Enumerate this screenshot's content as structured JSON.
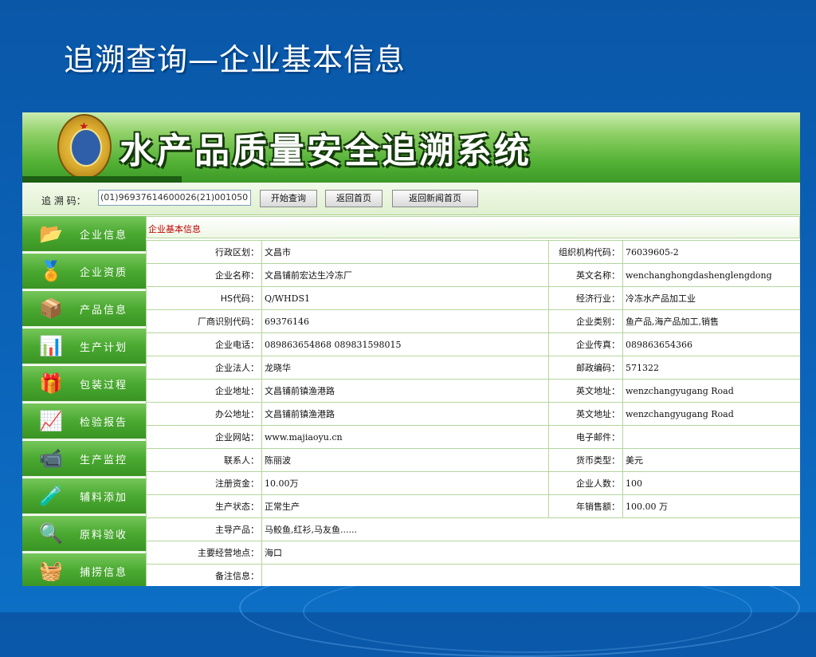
{
  "slide": {
    "title": "追溯查询—企业基本信息"
  },
  "app": {
    "title": "水产品质量安全追溯系统"
  },
  "search": {
    "label": "追 溯 码：",
    "value": "(01)96937614600026(21)001050",
    "buttons": [
      "开始查询",
      "返回首页",
      "返回新闻首页"
    ]
  },
  "sidebar": {
    "items": [
      {
        "label": "企业信息",
        "icon": "folder-icon"
      },
      {
        "label": "企业资质",
        "icon": "medal-icon"
      },
      {
        "label": "产品信息",
        "icon": "products-icon"
      },
      {
        "label": "生产计划",
        "icon": "bar-chart-icon"
      },
      {
        "label": "包装过程",
        "icon": "package-icon"
      },
      {
        "label": "检验报告",
        "icon": "report-icon"
      },
      {
        "label": "生产监控",
        "icon": "monitor-icon"
      },
      {
        "label": "辅料添加",
        "icon": "additive-icon"
      },
      {
        "label": "原料验收",
        "icon": "magnifier-icon"
      },
      {
        "label": "捕捞信息",
        "icon": "basket-icon"
      }
    ]
  },
  "section": {
    "title": "企业基本信息"
  },
  "info": {
    "rows": [
      {
        "l1": "行政区划：",
        "v1": "文昌市",
        "l2": "组织机构代码：",
        "v2": "76039605-2"
      },
      {
        "l1": "企业名称：",
        "v1": "文昌铺前宏达生冷冻厂",
        "l2": "英文名称：",
        "v2": "wenchanghongdashenglengdong"
      },
      {
        "l1": "HS代码：",
        "v1": "Q/WHDS1",
        "l2": "经济行业：",
        "v2": "冷冻水产品加工业"
      },
      {
        "l1": "厂商识别代码：",
        "v1": "69376146",
        "l2": "企业类别：",
        "v2": "鱼产品,海产品加工,销售"
      },
      {
        "l1": "企业电话：",
        "v1": "089863654868 089831598015",
        "l2": "企业传真：",
        "v2": "089863654366"
      },
      {
        "l1": "企业法人：",
        "v1": "龙晓华",
        "l2": "邮政编码：",
        "v2": "571322"
      },
      {
        "l1": "企业地址：",
        "v1": "文昌铺前镇渔港路",
        "l2": "英文地址：",
        "v2": "wenzchangyugang Road"
      },
      {
        "l1": "办公地址：",
        "v1": "文昌铺前镇渔港路",
        "l2": "英文地址：",
        "v2": "wenzchangyugang Road"
      },
      {
        "l1": "企业网站：",
        "v1": "www.majiaoyu.cn",
        "l2": "电子邮件：",
        "v2": ""
      },
      {
        "l1": "联系人：",
        "v1": "陈丽波",
        "l2": "货币类型：",
        "v2": "美元"
      },
      {
        "l1": "注册资金：",
        "v1": "10.00万",
        "l2": "企业人数：",
        "v2": "100"
      },
      {
        "l1": "生产状态：",
        "v1": "正常生产",
        "l2": "年销售额：",
        "v2": "100.00 万"
      }
    ],
    "wide_rows": [
      {
        "l": "主导产品：",
        "v": "马鲛鱼,红衫,马友鱼......"
      },
      {
        "l": "主要经营地点：",
        "v": "海口"
      },
      {
        "l": "备注信息：",
        "v": ""
      }
    ]
  }
}
